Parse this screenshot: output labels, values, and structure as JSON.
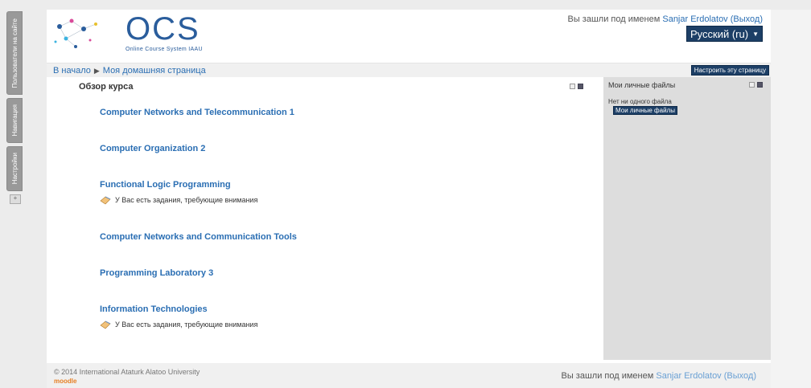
{
  "dock": {
    "tabs": [
      {
        "label": "Пользователи на сайте"
      },
      {
        "label": "Навигация"
      },
      {
        "label": "Настройки"
      }
    ]
  },
  "header": {
    "logo_text": "OCS",
    "logo_sub": "Online Course System IAAU",
    "login_prefix": "Вы зашли под именем ",
    "user_name": "Sanjar Erdolatov",
    "logout_label": "(Выход)",
    "language": "Русский (ru)"
  },
  "nav": {
    "home": "В начало",
    "current": "Моя домашняя страница",
    "customize_label": "Настроить эту страницу"
  },
  "main": {
    "block_title": "Обзор курса",
    "courses": [
      {
        "title": "Computer Networks and Telecommunication 1",
        "alert": ""
      },
      {
        "title": "Computer Organization 2",
        "alert": ""
      },
      {
        "title": "Functional Logic Programming",
        "alert": "У Вас есть задания, требующие внимания"
      },
      {
        "title": "Computer Networks and Communication Tools",
        "alert": ""
      },
      {
        "title": "Programming Laboratory 3",
        "alert": ""
      },
      {
        "title": "Information Technologies",
        "alert": "У Вас есть задания, требующие внимания"
      }
    ]
  },
  "sidebar": {
    "title": "Мои личные файлы",
    "empty_text": "Нет ни одного файла",
    "button_label": "Мои личные файлы"
  },
  "footer": {
    "copyright": "© 2014 International Ataturk Alatoo University",
    "moodle": "moodle",
    "login_prefix": "Вы зашли под именем ",
    "user_name": "Sanjar Erdolatov",
    "logout_label": "(Выход)"
  },
  "colors": {
    "link": "#2a6eb3",
    "accent_dark": "#1d3f66",
    "sidebar_bg": "#dddddd",
    "moodle_orange": "#e67e22"
  }
}
